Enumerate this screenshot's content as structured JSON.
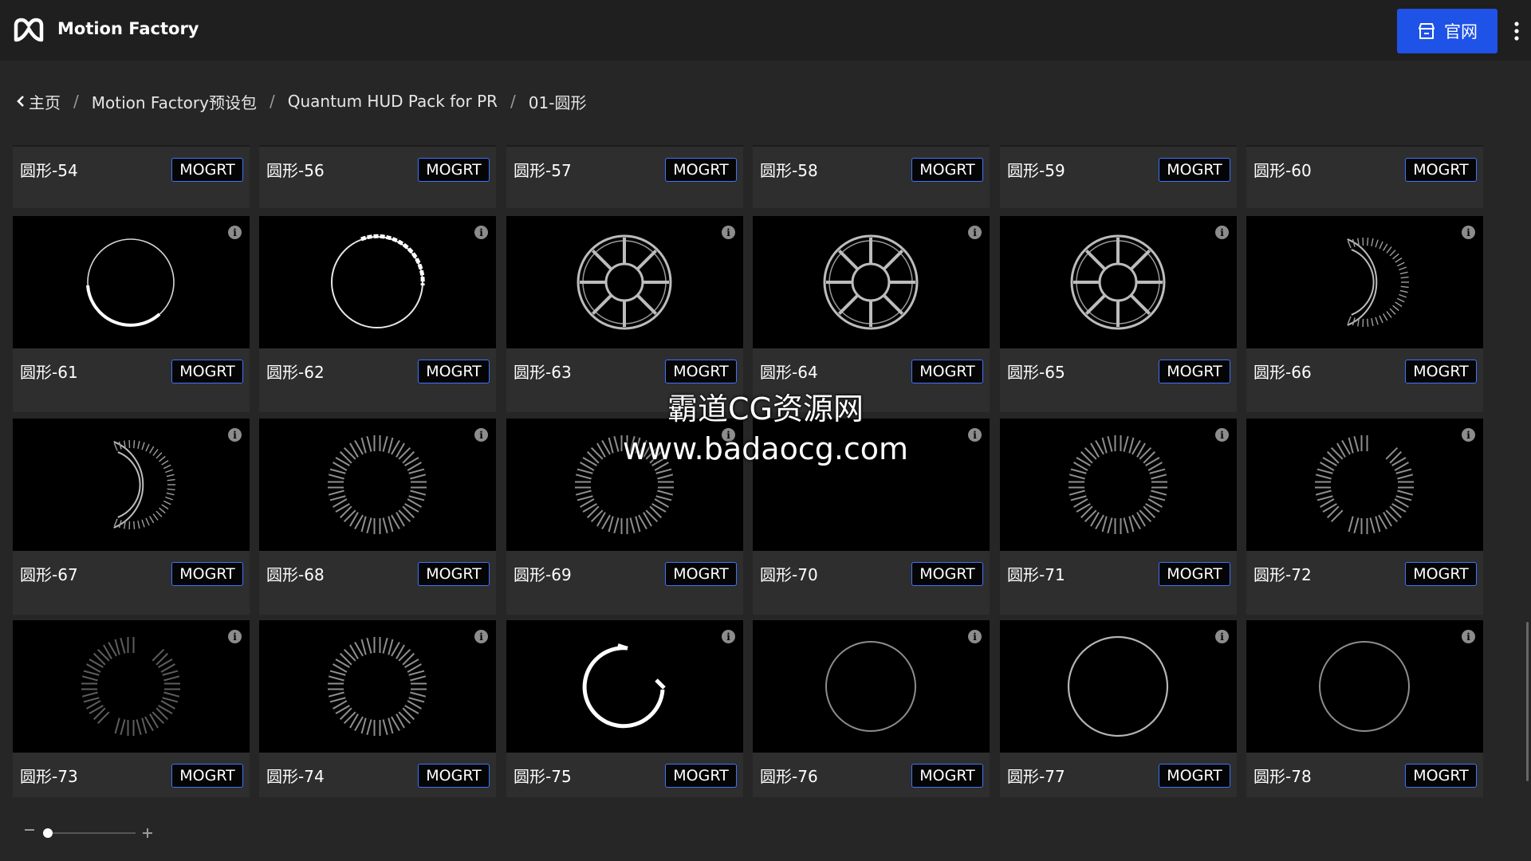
{
  "app": {
    "title": "Motion Factory"
  },
  "header": {
    "site_button_label": "官网"
  },
  "breadcrumb": {
    "items": [
      "主页",
      "Motion Factory预设包",
      "Quantum HUD Pack for PR",
      "01-圆形"
    ],
    "separator": "/"
  },
  "tiles_top_row": [
    {
      "name": "圆形-54",
      "badge": "MOGRT"
    },
    {
      "name": "圆形-56",
      "badge": "MOGRT"
    },
    {
      "name": "圆形-57",
      "badge": "MOGRT"
    },
    {
      "name": "圆形-58",
      "badge": "MOGRT"
    },
    {
      "name": "圆形-59",
      "badge": "MOGRT"
    },
    {
      "name": "圆形-60",
      "badge": "MOGRT"
    }
  ],
  "tiles": [
    {
      "name": "圆形-61",
      "badge": "MOGRT",
      "preview": "thin-circle-partial-thick"
    },
    {
      "name": "圆形-62",
      "badge": "MOGRT",
      "preview": "thin-circle-arc-top"
    },
    {
      "name": "圆形-63",
      "badge": "MOGRT",
      "preview": "spoked-wheel"
    },
    {
      "name": "圆形-64",
      "badge": "MOGRT",
      "preview": "spoked-wheel"
    },
    {
      "name": "圆形-65",
      "badge": "MOGRT",
      "preview": "spoked-wheel"
    },
    {
      "name": "圆形-66",
      "badge": "MOGRT",
      "preview": "ticked-arc-right"
    },
    {
      "name": "圆形-67",
      "badge": "MOGRT",
      "preview": "ticked-arc-right"
    },
    {
      "name": "圆形-68",
      "badge": "MOGRT",
      "preview": "segmented-ring"
    },
    {
      "name": "圆形-69",
      "badge": "MOGRT",
      "preview": "segmented-ring"
    },
    {
      "name": "圆形-70",
      "badge": "MOGRT",
      "preview": "empty"
    },
    {
      "name": "圆形-71",
      "badge": "MOGRT",
      "preview": "segmented-ring"
    },
    {
      "name": "圆形-72",
      "badge": "MOGRT",
      "preview": "segmented-ring-gaps"
    },
    {
      "name": "圆形-73",
      "badge": "MOGRT",
      "preview": "segmented-ring-gaps-dim"
    },
    {
      "name": "圆形-74",
      "badge": "MOGRT",
      "preview": "segmented-ring"
    },
    {
      "name": "圆形-75",
      "badge": "MOGRT",
      "preview": "thick-open-arc"
    },
    {
      "name": "圆形-76",
      "badge": "MOGRT",
      "preview": "thin-circle-dim"
    },
    {
      "name": "圆形-77",
      "badge": "MOGRT",
      "preview": "thin-circle"
    },
    {
      "name": "圆形-78",
      "badge": "MOGRT",
      "preview": "thin-circle-dim"
    }
  ],
  "watermark": {
    "line1": "霸道CG资源网",
    "line2": "www.badaocg.com"
  },
  "info_icon_glyph": "i",
  "zoom": {
    "minus": "−",
    "plus": "+",
    "level": 0.05
  },
  "colors": {
    "accent": "#1f52e6",
    "badge_border": "#3f73ff",
    "background": "#262626",
    "tile": "#2e2e2e"
  }
}
